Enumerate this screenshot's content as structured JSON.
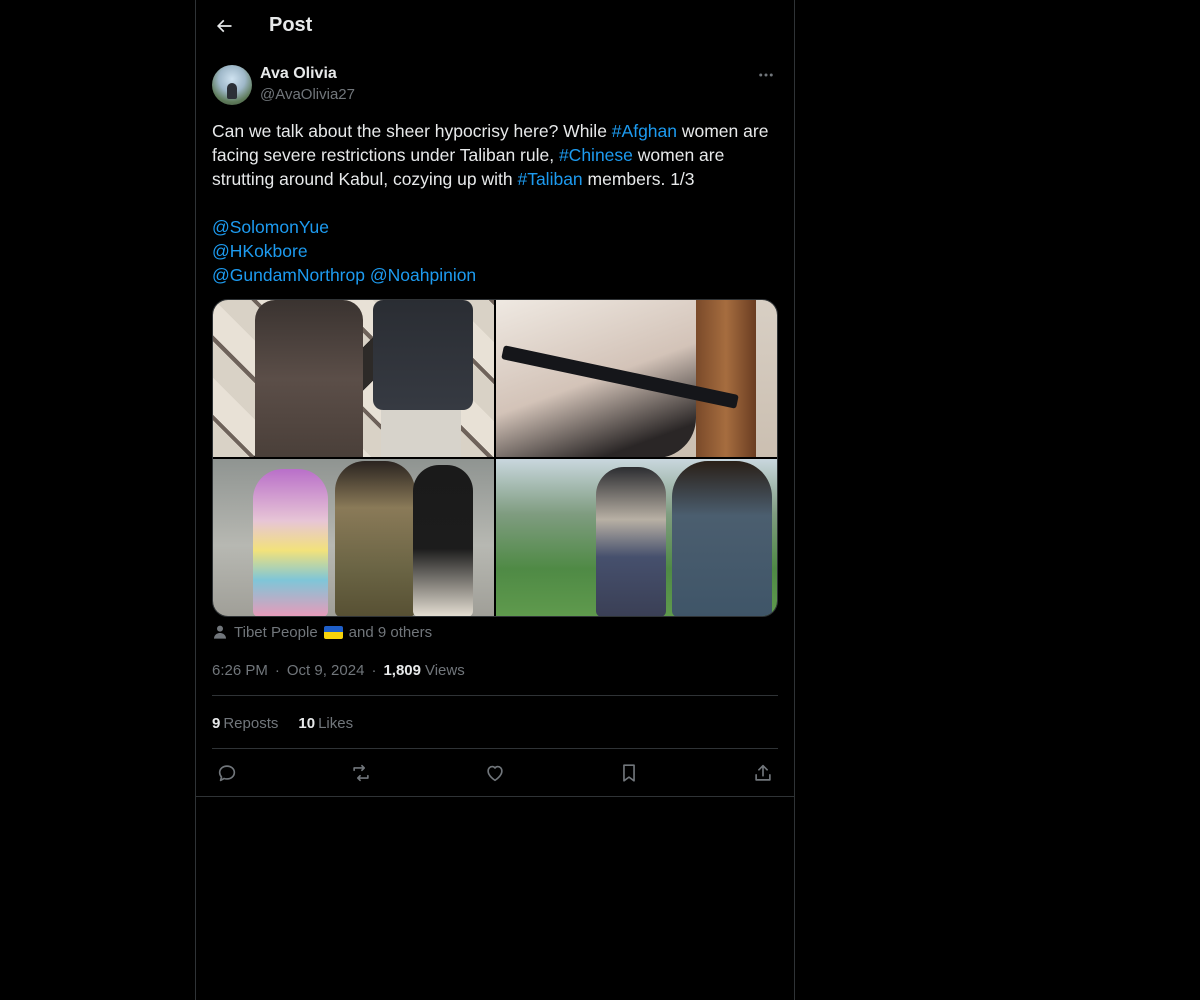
{
  "header": {
    "title": "Post"
  },
  "author": {
    "name": "Ava Olivia",
    "handle": "@AvaOlivia27"
  },
  "tweet": {
    "text_part1": "Can we talk about the sheer hypocrisy here? While ",
    "hashtag1": "#Afghan",
    "text_part2": " women are facing severe restrictions under Taliban rule, ",
    "hashtag2": "#Chinese",
    "text_part3": " women are strutting around Kabul, cozying up with ",
    "hashtag3": "#Taliban",
    "text_part4": " members. 1/3",
    "mentions": [
      "@SolomonYue",
      "@HKokbore",
      "@GundamNorthrop",
      "@Noahpinion"
    ]
  },
  "tagged": {
    "name": "Tibet People",
    "suffix": "and 9 others"
  },
  "meta": {
    "time": "6:26 PM",
    "date": "Oct 9, 2024",
    "views_count": "1,809",
    "views_label": "Views"
  },
  "stats": {
    "reposts_count": "9",
    "reposts_label": "Reposts",
    "likes_count": "10",
    "likes_label": "Likes"
  },
  "colors": {
    "background": "#000000",
    "text": "#e7e9ea",
    "secondary": "#71767b",
    "link": "#1d9bf0",
    "border": "#2f3336"
  }
}
